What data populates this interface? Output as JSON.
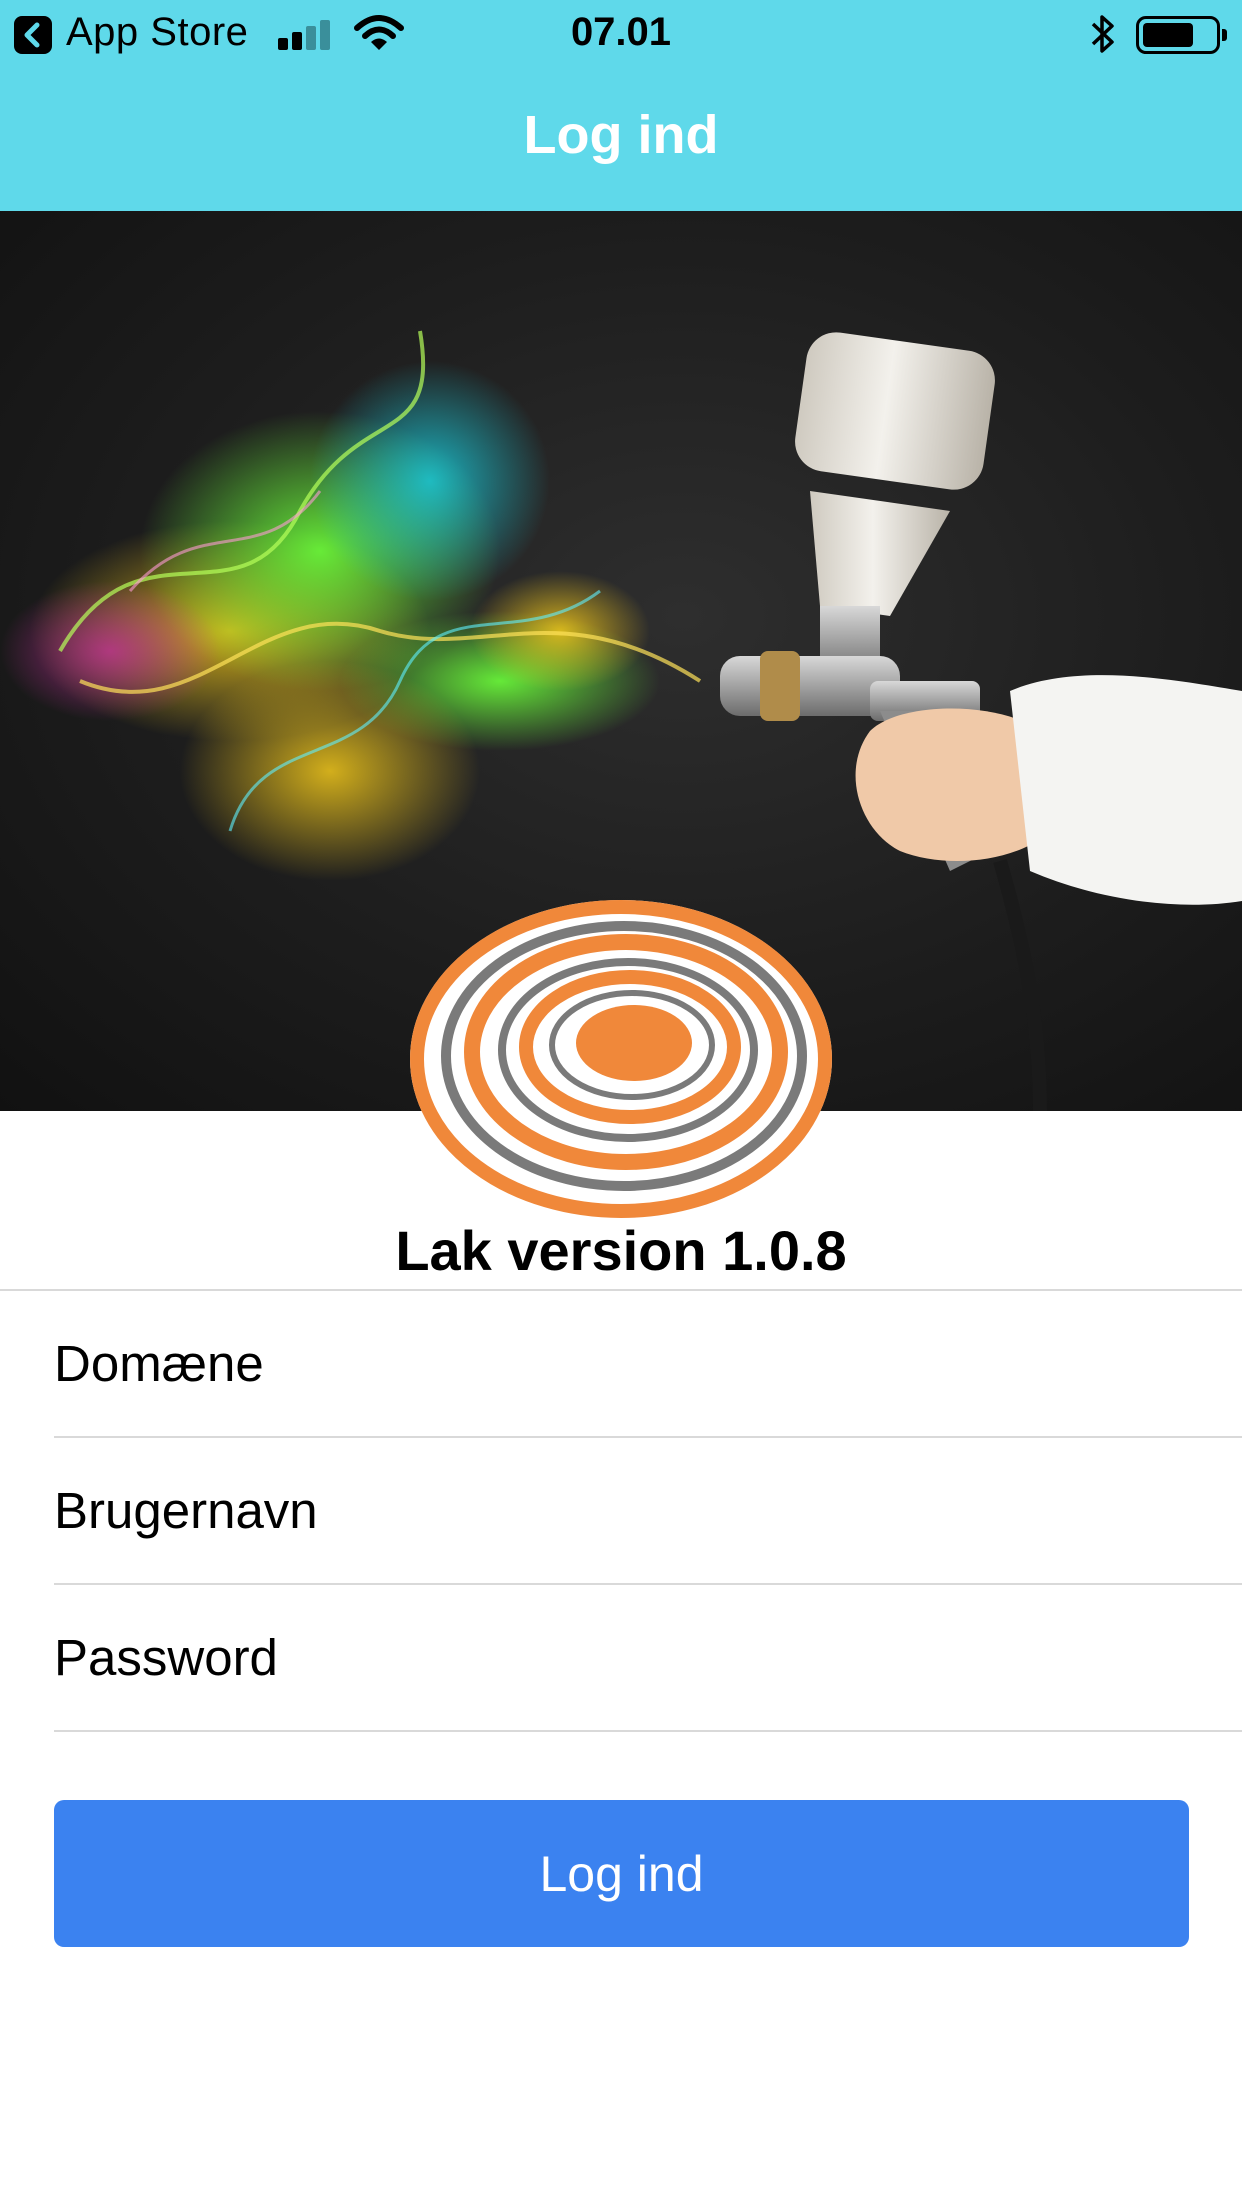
{
  "status_bar": {
    "back_app": "App Store",
    "time": "07.01",
    "icons": [
      "back-chevron-icon",
      "cellular-signal-icon",
      "wifi-icon",
      "bluetooth-icon",
      "battery-icon"
    ],
    "battery_level": 0.7
  },
  "nav": {
    "title": "Log ind"
  },
  "hero": {
    "description_icon": "spray-gun-image"
  },
  "app": {
    "version_label": "Lak version 1.0.8"
  },
  "form": {
    "domain_placeholder": "Domæne",
    "username_placeholder": "Brugernavn",
    "password_placeholder": "Password",
    "submit_label": "Log ind"
  },
  "colors": {
    "header_bg": "#5fd9ea",
    "button_bg": "#3b82f0",
    "logo_orange": "#f0883a",
    "logo_gray": "#7a7a7a"
  }
}
